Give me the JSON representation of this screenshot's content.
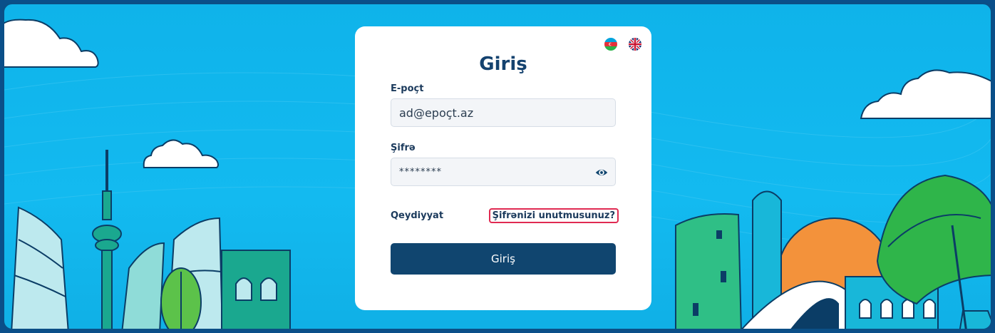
{
  "login": {
    "title": "Giriş",
    "email_label": "E-poçt",
    "email_value": "ad@epoçt.az",
    "password_label": "Şifrə",
    "password_value": "********",
    "register_link": "Qeydiyyat",
    "forgot_link": "Şifrənizi unutmusunuz?",
    "submit_label": "Giriş"
  },
  "languages": [
    {
      "code": "az",
      "icon": "azerbaijan-flag-icon"
    },
    {
      "code": "en",
      "icon": "uk-flag-icon"
    }
  ],
  "colors": {
    "background": "#13baf0",
    "primary": "#10456f",
    "highlight_border": "#e02a52"
  }
}
